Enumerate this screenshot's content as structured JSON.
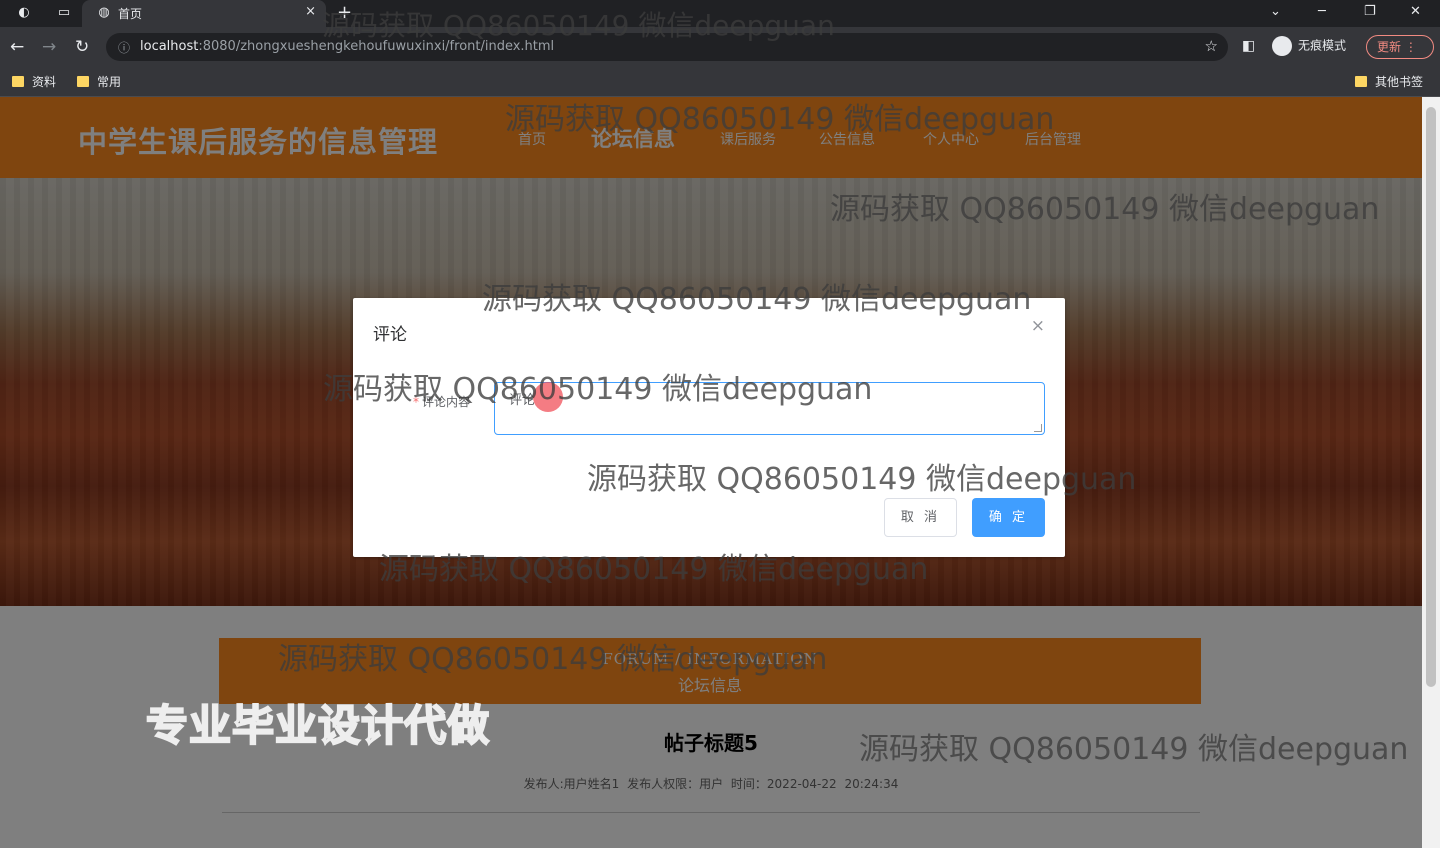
{
  "browser": {
    "tab_title": "首页",
    "tab_close": "×",
    "new_tab": "+",
    "url_host": "localhost",
    "url_rest": ":8080/zhongxueshengkehoufuwuxinxi/front/index.html",
    "incognito_label": "无痕模式",
    "update_label": "更新",
    "bookmarks": [
      "资料",
      "常用"
    ],
    "other_bookmarks": "其他书签"
  },
  "site": {
    "title": "中学生课后服务的信息管理",
    "nav": [
      "首页",
      "论坛信息",
      "课后服务",
      "公告信息",
      "个人中心",
      "后台管理"
    ]
  },
  "section": {
    "en": "FORUM / INFORMATION",
    "cn": "论坛信息"
  },
  "post": {
    "title": "帖子标题5",
    "meta": "发布人:用户姓名1  发布人权限：用户  时间：2022-04-22 20:24:34"
  },
  "dialog": {
    "title": "评论",
    "close": "×",
    "label": "评论内容",
    "required_mark": "*",
    "textarea_value": "评论",
    "cancel": "取 消",
    "confirm": "确 定"
  },
  "watermark": "源码获取 QQ86050149 微信deepguan",
  "promo": "专业毕业设计代做",
  "colors": {
    "brand_orange": "#ff8a1f",
    "primary_blue": "#409eff"
  }
}
